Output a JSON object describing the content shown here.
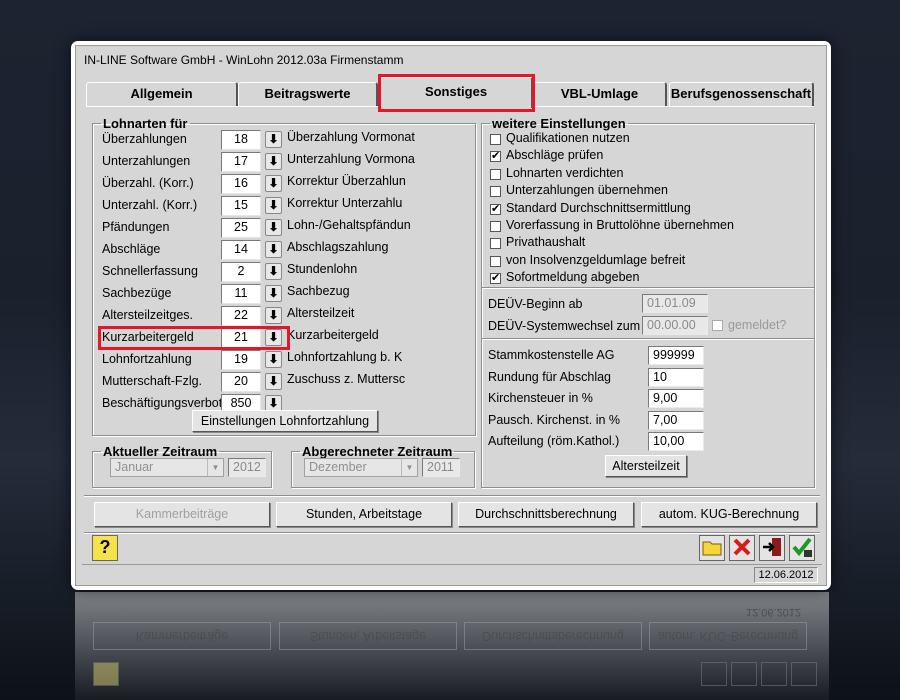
{
  "window": {
    "title": "IN-LINE Software GmbH - WinLohn 2012.03a  Firmenstamm"
  },
  "tabs": [
    {
      "label": "Allgemein",
      "active": false
    },
    {
      "label": "Beitragswerte",
      "active": false
    },
    {
      "label": "Sonstiges",
      "active": true
    },
    {
      "label": "VBL-Umlage",
      "active": false
    },
    {
      "label": "Berufsgenossenschaft",
      "active": false
    }
  ],
  "lohnarten": {
    "legend": "Lohnarten für",
    "rows": [
      {
        "label": "Überzahlungen",
        "value": "18",
        "desc": "Überzahlung Vormonat"
      },
      {
        "label": "Unterzahlungen",
        "value": "17",
        "desc": "Unterzahlung Vormona"
      },
      {
        "label": "Überzahl. (Korr.)",
        "value": "16",
        "desc": "Korrektur Überzahlun"
      },
      {
        "label": "Unterzahl. (Korr.)",
        "value": "15",
        "desc": "Korrektur Unterzahlu"
      },
      {
        "label": "Pfändungen",
        "value": "25",
        "desc": "Lohn-/Gehaltspfändun"
      },
      {
        "label": "Abschläge",
        "value": "14",
        "desc": "Abschlagszahlung"
      },
      {
        "label": "Schnellerfassung",
        "value": "2",
        "desc": "Stundenlohn"
      },
      {
        "label": "Sachbezüge",
        "value": "11",
        "desc": "Sachbezug"
      },
      {
        "label": "Altersteilzeitges.",
        "value": "22",
        "desc": "Altersteilzeit"
      },
      {
        "label": "Kurzarbeitergeld",
        "value": "21",
        "desc": "Kurzarbeitergeld"
      },
      {
        "label": "Lohnfortzahlung",
        "value": "19",
        "desc": "Lohnfortzahlung b. K"
      },
      {
        "label": "Mutterschaft-Fzlg.",
        "value": "20",
        "desc": "Zuschuss z. Muttersc"
      },
      {
        "label": "Beschäftigungsverbot",
        "value": "850",
        "desc": ""
      }
    ],
    "button": "Einstellungen Lohnfortzahlung"
  },
  "aktueller": {
    "legend": "Aktueller Zeitraum",
    "month": "Januar",
    "year": "2012"
  },
  "abgerechneter": {
    "legend": "Abgerechneter Zeitraum",
    "month": "Dezember",
    "year": "2011"
  },
  "weitere": {
    "legend": "weitere Einstellungen",
    "checks": [
      {
        "label": "Qualifikationen nutzen",
        "checked": false
      },
      {
        "label": "Abschläge prüfen",
        "checked": true
      },
      {
        "label": "Lohnarten verdichten",
        "checked": false
      },
      {
        "label": "Unterzahlungen übernehmen",
        "checked": false
      },
      {
        "label": "Standard Durchschnittsermittlung",
        "checked": true
      },
      {
        "label": "Vorerfassung in Bruttolöhne übernehmen",
        "checked": false
      },
      {
        "label": "Privathaushalt",
        "checked": false
      },
      {
        "label": "von  Insolvenzgeldumlage befreit",
        "checked": false
      },
      {
        "label": "Sofortmeldung abgeben",
        "checked": true
      }
    ],
    "deuev_beginn_label": "DEÜV-Beginn ab",
    "deuev_beginn_value": "01.01.09",
    "deuev_wechsel_label": "DEÜV-Systemwechsel zum",
    "deuev_wechsel_value": "00.00.00",
    "gemeldet_label": "gemeldet?",
    "fields": [
      {
        "label": "Stammkostenstelle AG",
        "value": "999999"
      },
      {
        "label": "Rundung für Abschlag",
        "value": "10"
      },
      {
        "label": "Kirchensteuer in %",
        "value": "9,00"
      },
      {
        "label": "Pausch. Kirchenst. in %",
        "value": "7,00"
      },
      {
        "label": "Aufteilung (röm.Kathol.)",
        "value": "10,00"
      }
    ],
    "altersteilzeit_button": "Altersteilzeit"
  },
  "bottom_buttons": [
    {
      "label": "Kammerbeiträge",
      "enabled": false
    },
    {
      "label": "Stunden, Arbeitstage",
      "enabled": true
    },
    {
      "label": "Durchschnittsberechnung",
      "enabled": true
    },
    {
      "label": "autom. KUG-Berechnung",
      "enabled": true
    }
  ],
  "status": {
    "date": "12.06.2012"
  },
  "icons": {
    "help": "help-icon",
    "open": "folder-icon",
    "cancel": "cancel-icon",
    "exit": "exit-door-icon",
    "save": "save-check-icon"
  },
  "colors": {
    "highlight": "#e3162a",
    "background": "#d6d6d6"
  }
}
